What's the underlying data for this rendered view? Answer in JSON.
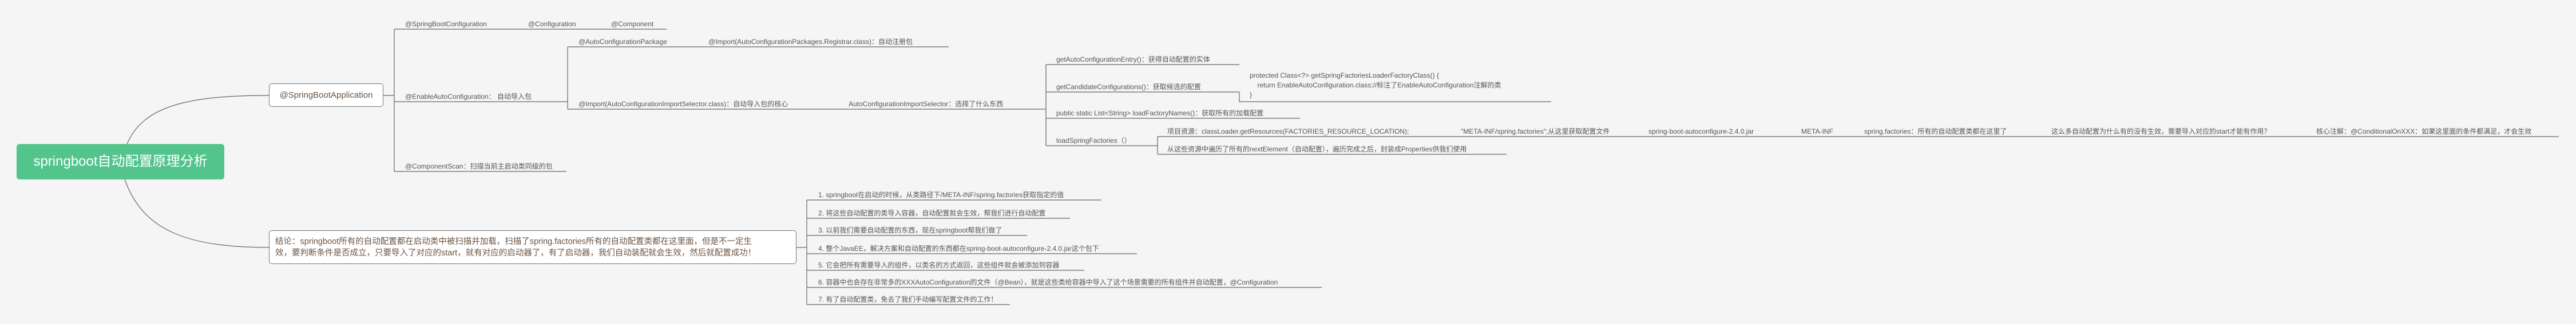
{
  "root": {
    "title": "springboot自动配置原理分析"
  },
  "colors": {
    "root_bg": "#52c48c",
    "background": "#f5f5f5",
    "node_text": "#6b5340",
    "line": "#666666"
  },
  "main_node": {
    "label": "@SpringBootApplication",
    "spring_boot_configuration": {
      "items": [
        "@SpringBootConfiguration",
        "@Configuration",
        "@Component"
      ]
    },
    "enable_auto_configuration": {
      "label": "@EnableAutoConfiguration： 自动导入包",
      "auto_configuration_package": {
        "label": "@AutoConfigurationPackage",
        "child": "@Import(AutoConfigurationPackages.Registrar.class)：自动注册包"
      },
      "import_selector": {
        "label": "@Import(AutoConfigurationImportSelector.class)：自动导入包的核心",
        "child": "AutoConfigurationImportSelector：选择了什么东西",
        "methods": {
          "entry": "getAutoConfigurationEntry()：获得自动配置的实体",
          "candidates": "getCandidateConfigurations()：获取候选的配置",
          "code": "protected Class<?> getSpringFactoriesLoaderFactoryClass() {\n    return EnableAutoConfiguration.class;//标注了EnableAutoConfiguration注解的类\n}",
          "load_factory_names": "public static List<String> loadFactoryNames()：获取所有的加载配置",
          "load_spring_factories": {
            "label": "loadSpringFactories（）",
            "resources_chain": [
              "项目资源：classLoader.getResources(FACTORIES_RESOURCE_LOCATION);",
              "\"META-INF/spring.factories\";从这里获取配置文件",
              "spring-boot-autoconfigure-2.4.0.jar",
              "META-INF",
              "spring.factories：所有的自动配置类都在这里了",
              "这么多自动配置为什么有的没有生效，需要导入对应的start才能有作用？",
              "核心注解：@ConditionalOnXXX：如果这里面的条件都满足，才会生效"
            ],
            "iterate": "从这些资源中遍历了所有的nextElement（自动配置），遍历完成之后，封装成Properties供我们使用"
          }
        }
      }
    },
    "component_scan": "@ComponentScan：扫描当前主启动类同级的包"
  },
  "conclusion": {
    "lines": [
      "结论：springboot所有的自动配置都在启动类中被扫描并加载，扫描了spring.factories所有的自动配置类都在这里面，但是不一定生",
      "效，要判断条件是否成立，只要导入了对应的start，就有对应的启动器了，有了启动器，我们自动装配就会生效，然后就配置成功！"
    ],
    "points": [
      "1. springboot在启动的时候，从类路径下/META-INF/spring.factories获取指定的值",
      "2. 将这些自动配置的类导入容器，自动配置就会生效，帮我们进行自动配置",
      "3. 以前我们需要自动配置的东西，现在springboot帮我们做了",
      "4. 整个JavaEE，解决方案和自动配置的东西都在spring-boot-autoconfigure-2.4.0.jar这个包下",
      "5. 它会把所有需要导入的组件，以类名的方式返回，这些组件就会被添加到容器",
      "6. 容器中也会存在非常多的XXXAutoConfiguration的文件（@Bean），就是这些类给容器中导入了这个场景需要的所有组件并自动配置，@Configuration",
      "7. 有了自动配置类，免去了我们手动编写配置文件的工作！"
    ]
  }
}
